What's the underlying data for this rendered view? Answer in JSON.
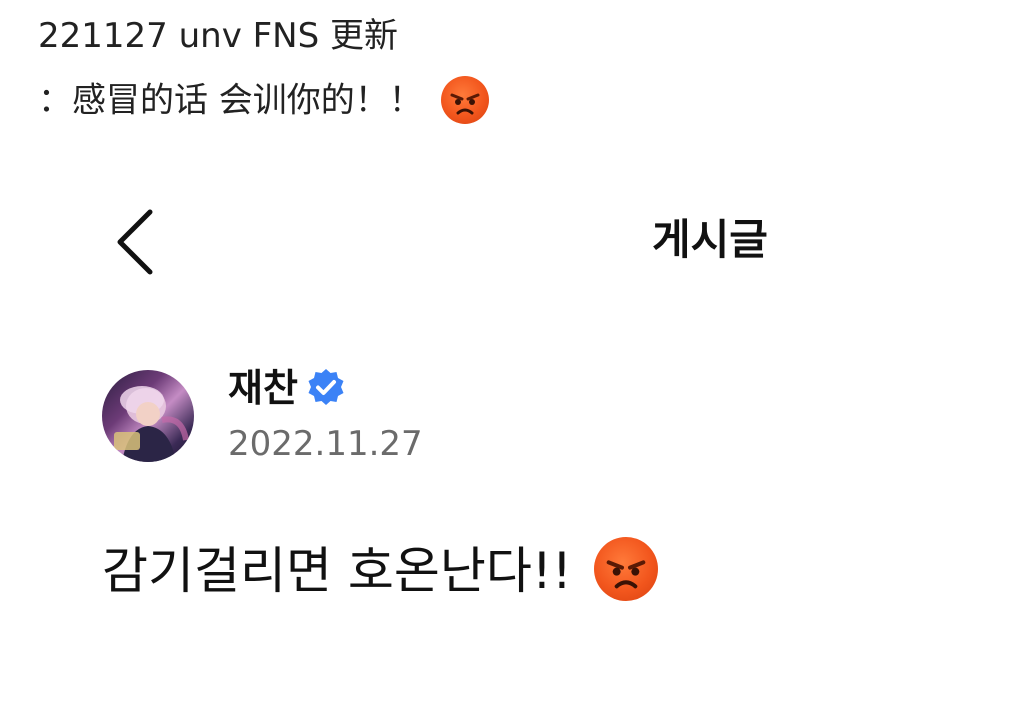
{
  "caption": {
    "line1": "221127 unv FNS 更新",
    "line2": "：感冒的话 会训你的！！",
    "emoji_icon": "angry-face-emoji"
  },
  "header": {
    "back_icon": "chevron-left-icon",
    "title": "게시글"
  },
  "post": {
    "author": "재찬",
    "verified_icon": "verified-badge-icon",
    "date": "2022.11.27",
    "text": "감기걸리면 호온난다!!",
    "emoji_icon": "angry-face-emoji"
  },
  "colors": {
    "verified_blue": "#3b82f6",
    "date_gray": "#6b6b6b",
    "emoji_orange": "#f2561d"
  }
}
